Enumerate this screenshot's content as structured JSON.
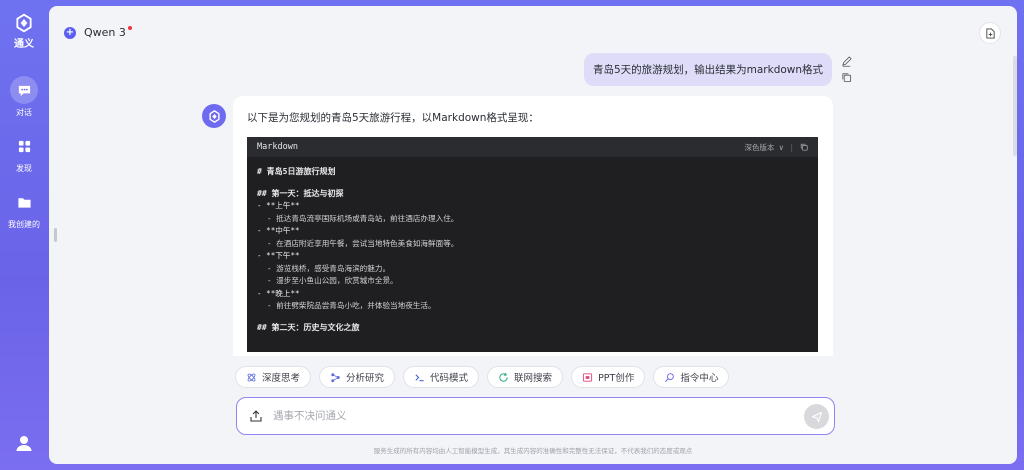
{
  "app": {
    "brand_name": "通义",
    "accent": "#6a63e8"
  },
  "sidebar": {
    "items": [
      {
        "label": "对话",
        "icon": "chat-icon",
        "active": true
      },
      {
        "label": "发现",
        "icon": "grid-icon",
        "active": false
      },
      {
        "label": "我创建的",
        "icon": "folder-icon",
        "active": false
      }
    ],
    "user_icon": "user-icon"
  },
  "header": {
    "model_name": "Qwen 3",
    "new_chat_icon": "new-chat-icon"
  },
  "conversation": {
    "user_message": "青岛5天的旅游规划，输出结果为markdown格式",
    "assistant_intro": "以下是为您规划的青岛5天旅游行程，以Markdown格式呈现：",
    "code_block": {
      "language": "Markdown",
      "theme_label": "深色版本",
      "lines": [
        {
          "text": "# 青岛5日游旅行规划",
          "kind": "h1"
        },
        {
          "text": "",
          "kind": "gap"
        },
        {
          "text": "## 第一天：抵达与初探",
          "kind": "h2"
        },
        {
          "text": "- **上午**",
          "kind": "item"
        },
        {
          "text": "- 抵达青岛流亭国际机场或青岛站，前往酒店办理入住。",
          "kind": "indent"
        },
        {
          "text": "- **中午**",
          "kind": "item"
        },
        {
          "text": "- 在酒店附近享用午餐，尝试当地特色美食如海鲜面等。",
          "kind": "indent"
        },
        {
          "text": "- **下午**",
          "kind": "item"
        },
        {
          "text": "- 游览栈桥，感受青岛海滨的魅力。",
          "kind": "indent"
        },
        {
          "text": "- 漫步至小鱼山公园，欣赏城市全景。",
          "kind": "indent"
        },
        {
          "text": "- **晚上**",
          "kind": "item"
        },
        {
          "text": "- 前往劈柴院品尝青岛小吃，并体验当地夜生活。",
          "kind": "indent"
        },
        {
          "text": "",
          "kind": "gap"
        },
        {
          "text": "## 第二天：历史与文化之旅",
          "kind": "h2"
        }
      ]
    }
  },
  "tools": [
    {
      "label": "深度思考",
      "icon": "atom-icon"
    },
    {
      "label": "分析研究",
      "icon": "share-nodes-icon"
    },
    {
      "label": "代码模式",
      "icon": "terminal-icon"
    },
    {
      "label": "联网搜索",
      "icon": "globe-refresh-icon"
    },
    {
      "label": "PPT创作",
      "icon": "ppt-icon"
    },
    {
      "label": "指令中心",
      "icon": "command-icon"
    }
  ],
  "composer": {
    "placeholder": "遇事不决问通义",
    "value": ""
  },
  "footer": {
    "disclaimer": "服务生成的所有内容均由人工智能模型生成，其生成内容的准确性和完整性无法保证，不代表我们的态度或观点"
  }
}
